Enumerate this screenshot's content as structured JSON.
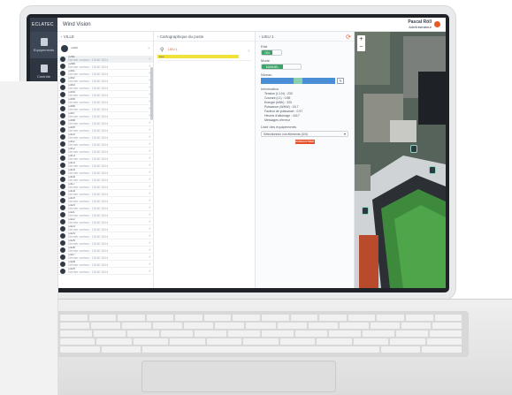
{
  "app": {
    "brand": "ECLATEC",
    "title": "Wind Vision"
  },
  "user": {
    "name": "Pascal Röll",
    "subtitle": "Administrateur"
  },
  "sidebar": {
    "items": [
      {
        "label": "Equipements",
        "icon": "building-icon"
      },
      {
        "label": "Contrôle",
        "icon": "grid-icon"
      }
    ]
  },
  "columns": {
    "ville_header": "VILLE",
    "carto_header": "Cartographique du poste",
    "lieu_header": "LIEU 1"
  },
  "ville_list": {
    "top_item": "1300",
    "rows": [
      {
        "title": "1281",
        "sub": "Dernier contact : 12h30 2024"
      },
      {
        "title": "1285",
        "sub": "Dernier contact : 12h30 2024"
      },
      {
        "title": "1301",
        "sub": "Dernier contact : 12h30 2024"
      },
      {
        "title": "1302",
        "sub": "Dernier contact : 12h30 2024"
      },
      {
        "title": "1303",
        "sub": "Dernier contact : 12h30 2024"
      },
      {
        "title": "1304",
        "sub": "Dernier contact : 12h30 2024"
      },
      {
        "title": "1305",
        "sub": "Dernier contact : 12h30 2024"
      },
      {
        "title": "1306",
        "sub": "Dernier contact : 12h30 2024"
      },
      {
        "title": "1307",
        "sub": "Dernier contact : 12h30 2024"
      },
      {
        "title": "1308",
        "sub": "Dernier contact : 12h30 2024"
      },
      {
        "title": "1309",
        "sub": "Dernier contact : 12h30 2024"
      },
      {
        "title": "1310",
        "sub": "Dernier contact : 12h30 2024"
      },
      {
        "title": "1311",
        "sub": "Dernier contact : 12h30 2024"
      },
      {
        "title": "1312",
        "sub": "Dernier contact : 12h30 2024"
      },
      {
        "title": "1313",
        "sub": "Dernier contact : 12h30 2024"
      },
      {
        "title": "1314",
        "sub": "Dernier contact : 12h30 2024"
      },
      {
        "title": "1315",
        "sub": "Dernier contact : 12h30 2024"
      },
      {
        "title": "1316",
        "sub": "Dernier contact : 12h30 2024"
      },
      {
        "title": "1317",
        "sub": "Dernier contact : 12h30 2024"
      },
      {
        "title": "1318",
        "sub": "Dernier contact : 12h30 2024"
      },
      {
        "title": "1319",
        "sub": "Dernier contact : 12h30 2024"
      },
      {
        "title": "1320",
        "sub": "Dernier contact : 12h30 2024"
      },
      {
        "title": "1321",
        "sub": "Dernier contact : 12h30 2024"
      },
      {
        "title": "1322",
        "sub": "Dernier contact : 12h30 2024"
      },
      {
        "title": "1323",
        "sub": "Dernier contact : 12h30 2024"
      },
      {
        "title": "1324",
        "sub": "Dernier contact : 12h30 2024"
      },
      {
        "title": "1325",
        "sub": "Dernier contact : 12h30 2024"
      },
      {
        "title": "1326",
        "sub": "Dernier contact : 12h30 2024"
      },
      {
        "title": "1327",
        "sub": "Dernier contact : 12h30 2024"
      },
      {
        "title": "1328",
        "sub": "Dernier contact : 12h30 2024"
      },
      {
        "title": "1329",
        "sub": "Dernier contact : 12h30 2024"
      }
    ]
  },
  "carto": {
    "item_label": "LIEU 1",
    "item_bar": "Lieu"
  },
  "lieu": {
    "etat_label": "Etat",
    "etat_value": "ON",
    "mode_label": "Mode",
    "mode_value": "MANUEL",
    "niveau_label": "Niveau",
    "niveau_fraction": 0.5,
    "info_label": "Information",
    "info_lines": [
      "Tension (L1-N) : 233",
      "Courant (L1) : 0.85",
      "Energie (kWh) : 320",
      "Puissance (W/kW) : 18.7",
      "Facteur de puissance : 0.97",
      "Heures d'allumage : 4417",
      "Messages d'erreur"
    ],
    "select_label": "Liste des équipements",
    "select_value": "Sélectionnez vos éléments (0/4)",
    "action_label": "ENREGISTRER"
  },
  "map": {
    "zoom_in": "+",
    "zoom_out": "−"
  },
  "colors": {
    "accent": "#e85a2a",
    "sidebar": "#2d3540",
    "green": "#3ea36b",
    "blue": "#4a8fd6"
  }
}
